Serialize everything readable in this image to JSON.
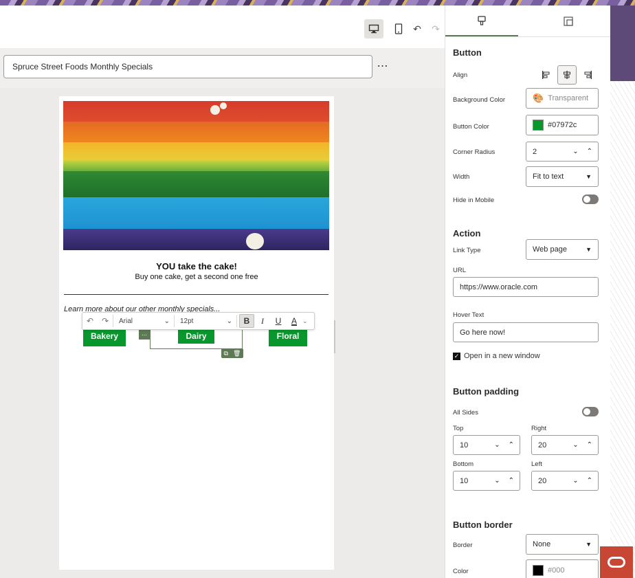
{
  "editor": {
    "title_value": "Spruce Street Foods Monthly Specials",
    "more_label": "⋯"
  },
  "email": {
    "headline": "YOU take the cake!",
    "subline": "Buy one cake, get a second one free",
    "learn_more": "Learn more about our other monthly specials...",
    "buttons": [
      "Bakery",
      "Dairy",
      "Floral"
    ]
  },
  "rte": {
    "font": "Arial",
    "size": "12pt",
    "bold": "B",
    "italic": "I",
    "underline": "U",
    "color": "A"
  },
  "panel": {
    "section_button": "Button",
    "align_label": "Align",
    "bg_color_label": "Background Color",
    "bg_color_value": "Transparent",
    "button_color_label": "Button Color",
    "button_color_value": "#07972c",
    "corner_radius_label": "Corner Radius",
    "corner_radius_value": "2",
    "width_label": "Width",
    "width_value": "Fit to text",
    "hide_mobile_label": "Hide in Mobile",
    "section_action": "Action",
    "link_type_label": "Link Type",
    "link_type_value": "Web page",
    "url_label": "URL",
    "url_value": "https://www.oracle.com",
    "hover_label": "Hover Text",
    "hover_value": "Go here now!",
    "open_new_window_label": "Open in a new window",
    "section_padding": "Button padding",
    "all_sides_label": "All Sides",
    "top_label": "Top",
    "top_value": "10",
    "right_label": "Right",
    "right_value": "20",
    "bottom_label": "Bottom",
    "bottom_value": "10",
    "left_label": "Left",
    "left_value": "20",
    "section_border": "Button border",
    "border_label": "Border",
    "border_value": "None",
    "color_label": "Color",
    "color_value": "#000"
  },
  "colors": {
    "button_green": "#07972c",
    "selection_green": "#5d7a55",
    "oracle_red": "#c74634"
  }
}
